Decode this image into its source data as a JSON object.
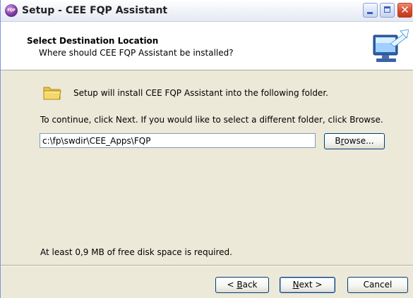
{
  "window": {
    "title": "Setup - CEE FQP Assistant",
    "app_icon_text": "FQP",
    "close_glyph": "✕"
  },
  "header": {
    "title": "Select Destination Location",
    "subtitle": "Where should CEE FQP Assistant be installed?",
    "image": "setup-wizard-computer-icon"
  },
  "body": {
    "install_text": "Setup will install CEE FQP Assistant into the following folder.",
    "continue_text": "To continue, click Next. If you would like to select a different folder, click Browse.",
    "path_value": "c:\\fp\\swdir\\CEE_Apps\\FQP",
    "browse": {
      "pre": "B",
      "accel": "r",
      "post": "owse..."
    },
    "disk_space_text": "At least 0,9 MB of free disk space is required."
  },
  "footer": {
    "back": {
      "pre": "< ",
      "accel": "B",
      "post": "ack"
    },
    "next": {
      "pre": "",
      "accel": "N",
      "post": "ext >"
    },
    "cancel": "Cancel"
  },
  "colors": {
    "window_bg": "#ece9d8",
    "close_button": "#d4472a",
    "button_border": "#003c74",
    "folder_yellow": "#f5d86a"
  },
  "icons": [
    "app-icon",
    "minimize-icon",
    "maximize-icon",
    "close-icon",
    "folder-icon",
    "setup-wizard-computer-icon"
  ]
}
